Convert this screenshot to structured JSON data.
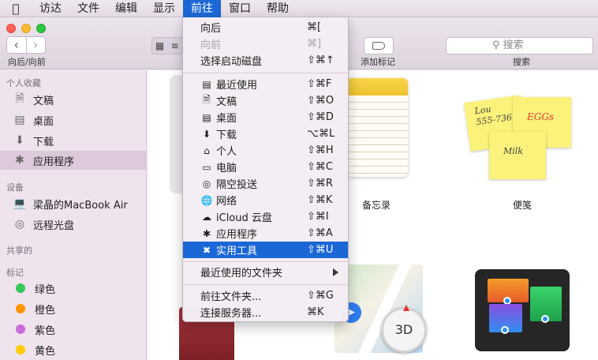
{
  "menubar": {
    "items": [
      {
        "label": "访达"
      },
      {
        "label": "文件"
      },
      {
        "label": "编辑"
      },
      {
        "label": "显示"
      },
      {
        "label": "前往"
      },
      {
        "label": "窗口"
      },
      {
        "label": "帮助"
      }
    ]
  },
  "toolbar": {
    "nav_label": "向后/向前",
    "tag_label": "添加标记",
    "search_placeholder": "搜索",
    "search_label": "搜索"
  },
  "sidebar": {
    "favorites_title": "个人收藏",
    "favorites": [
      {
        "label": "文稿",
        "icon": "document-icon"
      },
      {
        "label": "桌面",
        "icon": "desktop-icon"
      },
      {
        "label": "下载",
        "icon": "download-icon"
      },
      {
        "label": "应用程序",
        "icon": "applications-icon",
        "selected": true
      }
    ],
    "devices_title": "设备",
    "devices": [
      {
        "label": "梁晶的MacBook Air",
        "icon": "laptop-icon"
      },
      {
        "label": "远程光盘",
        "icon": "disc-icon"
      }
    ],
    "shared_title": "共享的",
    "tags_title": "标记",
    "tags": [
      {
        "label": "绿色",
        "color": "#34c759"
      },
      {
        "label": "橙色",
        "color": "#ff9500"
      },
      {
        "label": "紫色",
        "color": "#c86dd7"
      },
      {
        "label": "黄色",
        "color": "#ffcc00"
      }
    ]
  },
  "content": {
    "apps": [
      {
        "label": "备忘录"
      },
      {
        "label": "便笺"
      }
    ],
    "stickies": {
      "note1_line1": "Lou",
      "note1_line2": "555-7361",
      "note2": "EGGs",
      "note3": "Milk"
    },
    "compass_text": "3D"
  },
  "go_menu": {
    "items": [
      {
        "label": "向后",
        "shortcut": "⌘[",
        "icon": ""
      },
      {
        "label": "向前",
        "shortcut": "⌘]",
        "icon": "",
        "disabled": true
      },
      {
        "label": "选择启动磁盘",
        "shortcut": "⇧⌘↑",
        "icon": ""
      },
      {
        "label": "最近使用",
        "shortcut": "⇧⌘F",
        "icon": "recents-icon"
      },
      {
        "label": "文稿",
        "shortcut": "⇧⌘O",
        "icon": "document-icon"
      },
      {
        "label": "桌面",
        "shortcut": "⇧⌘D",
        "icon": "desktop-icon"
      },
      {
        "label": "下载",
        "shortcut": "⌥⌘L",
        "icon": "download-icon"
      },
      {
        "label": "个人",
        "shortcut": "⇧⌘H",
        "icon": "home-icon"
      },
      {
        "label": "电脑",
        "shortcut": "⇧⌘C",
        "icon": "computer-icon"
      },
      {
        "label": "隔空投送",
        "shortcut": "⇧⌘R",
        "icon": "airdrop-icon"
      },
      {
        "label": "网络",
        "shortcut": "⇧⌘K",
        "icon": "network-icon"
      },
      {
        "label": "iCloud 云盘",
        "shortcut": "⇧⌘I",
        "icon": "cloud-icon"
      },
      {
        "label": "应用程序",
        "shortcut": "⇧⌘A",
        "icon": "applications-icon"
      },
      {
        "label": "实用工具",
        "shortcut": "⇧⌘U",
        "icon": "utilities-icon",
        "highlighted": true
      },
      {
        "label": "最近使用的文件夹",
        "shortcut": "",
        "icon": ""
      },
      {
        "label": "前往文件夹...",
        "shortcut": "⇧⌘G",
        "icon": ""
      },
      {
        "label": "连接服务器...",
        "shortcut": "⌘K",
        "icon": ""
      }
    ]
  }
}
